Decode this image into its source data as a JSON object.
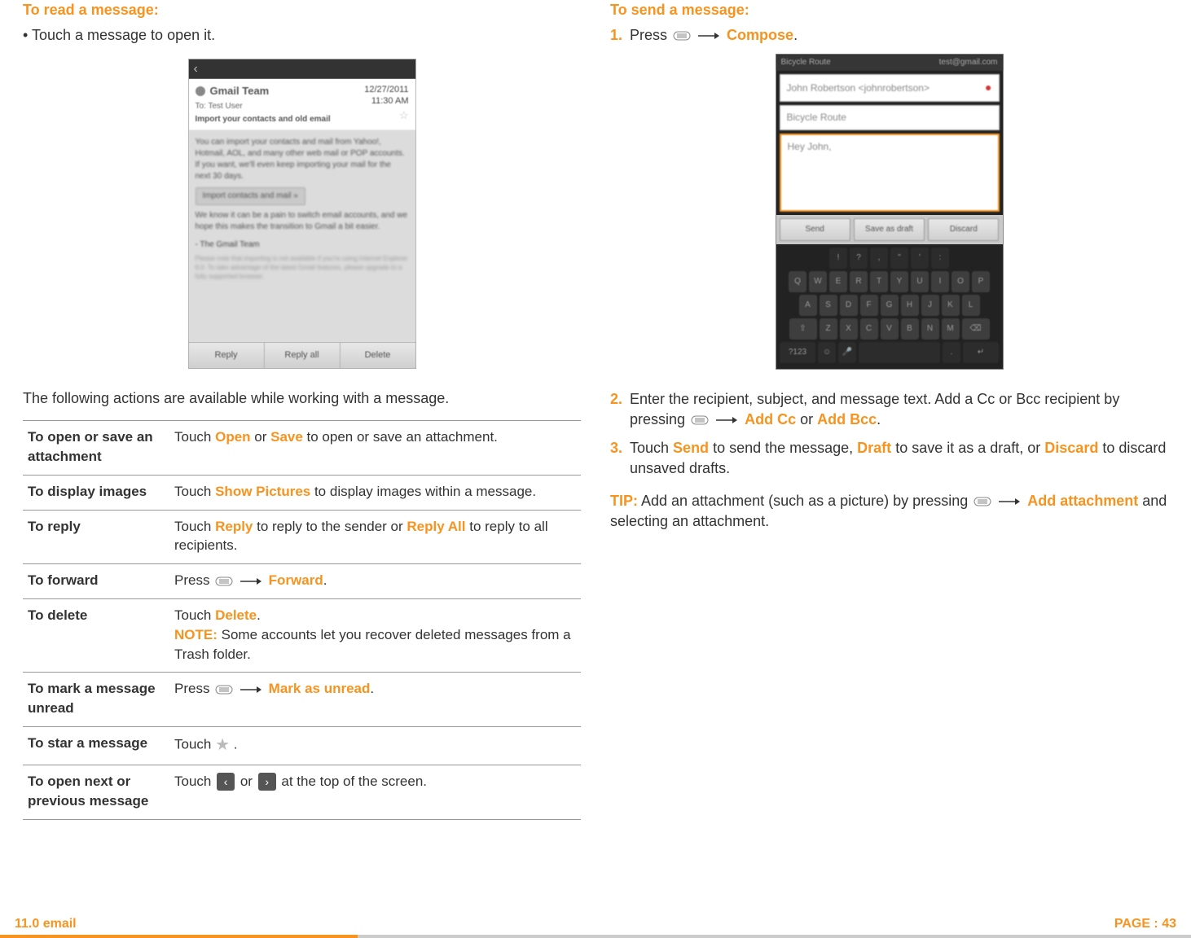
{
  "left": {
    "heading": "To read a message:",
    "bullet": "• Touch a message to open it.",
    "screenshot": {
      "from": "Gmail Team",
      "date": "12/27/2011",
      "time": "11:30 AM",
      "to": "To: Test User",
      "subject": "Import your contacts and old email",
      "body1": "You can import your contacts and mail from Yahoo!, Hotmail, AOL, and many other web mail or POP accounts. If you want, we'll even keep importing your mail for the next 30 days.",
      "import_btn": "Import contacts and mail »",
      "body2": "We know it can be a pain to switch email accounts, and we hope this makes the transition to Gmail a bit easier.",
      "sign": "- The Gmail Team",
      "fine": "Please note that importing is not available if you're using Internet Explorer 6.0. To take advantage of the latest Gmail features, please upgrade to a fully supported browser.",
      "btn_reply": "Reply",
      "btn_reply_all": "Reply all",
      "btn_delete": "Delete"
    },
    "intro": "The following actions are available while working with a message.",
    "table": {
      "r1_label": "To open or save an attachment",
      "r1_a": "Touch ",
      "r1_open": "Open",
      "r1_b": " or ",
      "r1_save": "Save",
      "r1_c": " to open or save an attachment.",
      "r2_label": "To display images",
      "r2_a": "Touch ",
      "r2_show": "Show Pictures",
      "r2_b": " to display images within a message.",
      "r3_label": "To reply",
      "r3_a": "Touch ",
      "r3_reply": "Reply",
      "r3_b": " to reply to the sender or ",
      "r3_replyall": "Reply All",
      "r3_c": " to reply to all recipients.",
      "r4_label": "To forward",
      "r4_a": "Press ",
      "r4_forward": "Forward",
      "r4_dot": ".",
      "r5_label": "To delete",
      "r5_a": "Touch ",
      "r5_delete": "Delete",
      "r5_dot": ".",
      "r5_note_label": "NOTE:",
      "r5_note": " Some accounts let you recover deleted messages from a Trash folder.",
      "r6_label": "To mark a message unread",
      "r6_a": "Press ",
      "r6_mark": "Mark as unread",
      "r6_dot": ".",
      "r7_label": "To star a message",
      "r7_a": "Touch ",
      "r7_dot": " .",
      "r8_label": "To open next or previous message",
      "r8_a": "Touch ",
      "r8_or": " or ",
      "r8_b": " at the top of the screen."
    }
  },
  "right": {
    "heading": "To send a message:",
    "step1_pre": "Press ",
    "step1_compose": "Compose",
    "step1_dot": ".",
    "compose": {
      "title_left": "Bicycle Route",
      "title_right": "test@gmail.com",
      "to": "John Robertson <johnrobertson>",
      "subject": "Bicycle Route",
      "body": "Hey John,",
      "btn_send": "Send",
      "btn_save": "Save as draft",
      "btn_discard": "Discard"
    },
    "step2_pre": "Enter the recipient, subject, and message text. Add a Cc or Bcc recipient by pressing ",
    "step2_addcc": "Add Cc",
    "step2_or": " or ",
    "step2_addbcc": "Add Bcc",
    "step2_dot": ".",
    "step3_pre": "Touch ",
    "step3_send": "Send",
    "step3_mid1": " to send the message, ",
    "step3_draft": "Draft",
    "step3_mid2": " to save it as a draft, or ",
    "step3_discard": "Discard",
    "step3_end": " to discard unsaved drafts.",
    "tip_label": "TIP:",
    "tip_a": " Add an attachment (such as a picture) by pressing ",
    "tip_add": "Add attachment",
    "tip_b": " and selecting an attachment."
  },
  "footer": {
    "left": "11.0 email",
    "right": "PAGE : 43"
  }
}
